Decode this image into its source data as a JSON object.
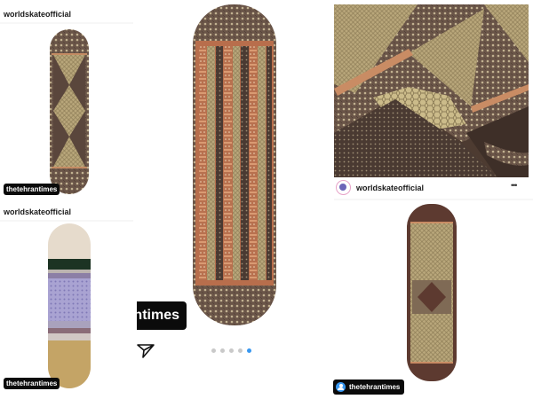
{
  "panels": {
    "top_left": {
      "account": "worldskateofficial",
      "tag": "thetehrantimes"
    },
    "bottom_left": {
      "account": "worldskateofficial",
      "tag": "thetehrantimes"
    },
    "center": {
      "tag": "thetehrantimes",
      "carousel": {
        "count": 5,
        "active_index": 4
      }
    },
    "top_right": {
      "account": "worldskateofficial",
      "more": "•••"
    },
    "bottom_right": {
      "tag": "thetehrantimes"
    }
  },
  "colors": {
    "wood": "#5e4a3e",
    "gold": "#b9a980",
    "copper": "#c07a55",
    "dark_inlay": "#3c302b",
    "cream": "#e8ddd0",
    "dark_green": "#1d3324",
    "lavender": "#a6a0d0",
    "mustard": "#c4a467",
    "accent": "#3897f0"
  },
  "icons": [
    "send-icon",
    "more-icon",
    "person-tag-icon",
    "avatar"
  ]
}
